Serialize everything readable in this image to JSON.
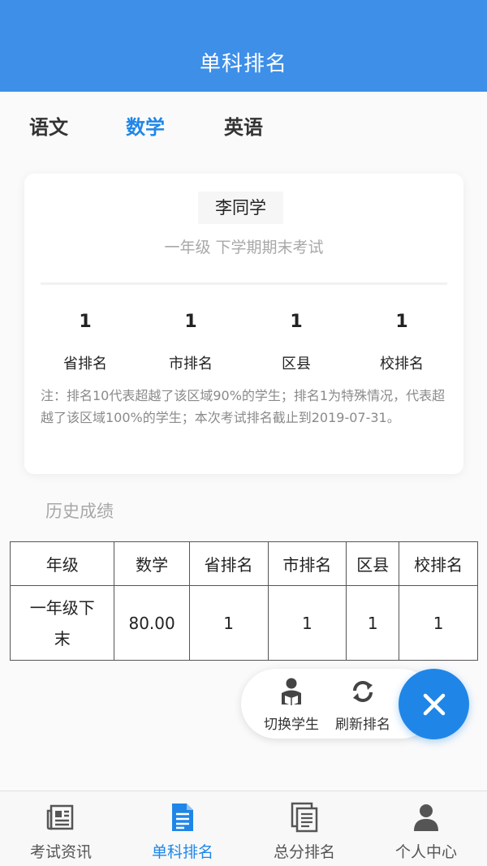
{
  "header": {
    "title": "单科排名"
  },
  "subjects": [
    {
      "label": "语文",
      "active": false
    },
    {
      "label": "数学",
      "active": true
    },
    {
      "label": "英语",
      "active": false
    }
  ],
  "card": {
    "student_name": "李同学",
    "exam_name": "一年级 下学期期末考试",
    "ranks": [
      {
        "label": "省排名",
        "value": "1"
      },
      {
        "label": "市排名",
        "value": "1"
      },
      {
        "label": "区县",
        "value": "1"
      },
      {
        "label": "校排名",
        "value": "1"
      }
    ],
    "note": "注：排名10代表超越了该区域90%的学生；排名1为特殊情况，代表超越了该区域100%的学生；本次考试排名截止到2019-07-31。"
  },
  "history": {
    "title": "历史成绩",
    "headers": [
      "年级",
      "数学",
      "省排名",
      "市排名",
      "区县",
      "校排名"
    ],
    "rows": [
      [
        "一年级下末",
        "80.00",
        "1",
        "1",
        "1",
        "1"
      ]
    ]
  },
  "fab": {
    "switch_student_label": "切换学生",
    "refresh_rank_label": "刷新排名"
  },
  "tabbar": [
    {
      "label": "考试资讯",
      "icon": "news-icon",
      "active": false
    },
    {
      "label": "单科排名",
      "icon": "document-icon",
      "active": true
    },
    {
      "label": "总分排名",
      "icon": "stack-document-icon",
      "active": false
    },
    {
      "label": "个人中心",
      "icon": "person-icon",
      "active": false
    }
  ],
  "colors": {
    "primary": "#3d8fe8",
    "accent": "#1f86e8",
    "muted": "#a8a8a8"
  }
}
